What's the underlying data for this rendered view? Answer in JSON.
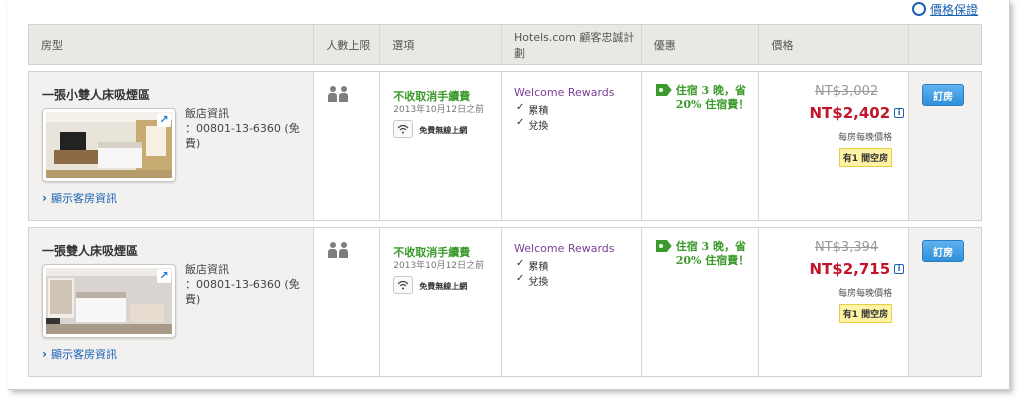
{
  "header": {
    "price_guarantee_label": "價格保證"
  },
  "table": {
    "columns": [
      "房型",
      "人數上限",
      "選項",
      "Hotels.com 顧客忠誠計劃",
      "優惠",
      "價格"
    ],
    "rows": [
      {
        "room_name": "一張小雙人床吸煙區",
        "hotel_info_label": "飯店資訊",
        "hotel_phone": "：00801-13-6360 (免費)",
        "show_room_info": "顯示客房資訊",
        "free_cancel": "不收取消手續費",
        "cancel_deadline": "2013年10月12日之前",
        "wifi_label": "免費無線上網",
        "rewards_title": "Welcome Rewards",
        "reward_items": [
          "累積",
          "兌換"
        ],
        "deal_line1": "住宿 3 晚，省",
        "deal_line2": "20% 住宿費！",
        "old_price": "NT$3,002",
        "new_price": "NT$2,402",
        "per_night": "每房每晚價格",
        "rooms_left": "有1 間空房",
        "book_label": "訂房"
      },
      {
        "room_name": "一張雙人床吸煙區",
        "hotel_info_label": "飯店資訊",
        "hotel_phone": "：00801-13-6360 (免費)",
        "show_room_info": "顯示客房資訊",
        "free_cancel": "不收取消手續費",
        "cancel_deadline": "2013年10月12日之前",
        "wifi_label": "免費無線上網",
        "rewards_title": "Welcome Rewards",
        "reward_items": [
          "累積",
          "兌換"
        ],
        "deal_line1": "住宿 3 晚，省",
        "deal_line2": "20% 住宿費！",
        "old_price": "NT$3,394",
        "new_price": "NT$2,715",
        "per_night": "每房每晚價格",
        "rooms_left": "有1 間空房",
        "book_label": "訂房"
      }
    ]
  },
  "icons": {
    "guests": "people-icon",
    "wifi": "wifi-icon",
    "deal": "tag-icon",
    "info": "info-icon",
    "expand": "expand-arrow-icon",
    "link": "chevron-right-icon",
    "check": "check-icon"
  },
  "colors": {
    "accent_blue": "#1a62b3",
    "price_red": "#c0152b",
    "deal_green": "#3a9a2a",
    "rewards_purple": "#7b3f98",
    "button_blue": "#2f8fd8"
  }
}
